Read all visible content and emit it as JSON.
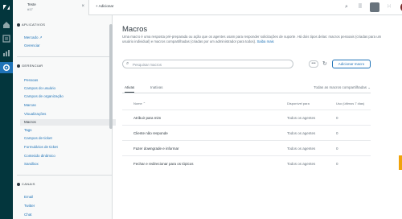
{
  "topbar": {
    "tab_title": "Teste",
    "tab_subtitle": "#17",
    "tab_close": "×",
    "add_tab": "+ Adicionar"
  },
  "sidebar": {
    "sections": [
      {
        "title": "APLICATIVOS",
        "items": [
          "Mercado ↗",
          "Gerenciar"
        ]
      },
      {
        "title": "GERENCIAR",
        "items": [
          "Pessoas",
          "Campos do usuário",
          "Campos de organização",
          "Marcas",
          "Visualizações",
          "Macros",
          "Tags",
          "Campos de ticket",
          "Formulários de ticket",
          "Conteúdo dinâmico",
          "Sandbox"
        ]
      },
      {
        "title": "CANAIS",
        "items": [
          "Email",
          "Twitter",
          "Chat"
        ]
      }
    ],
    "selected": "Macros"
  },
  "main": {
    "title": "Macros",
    "description": "Uma macro é uma resposta pré-preparada ou ação que os agentes usam para responder solicitações de suporte. Há dois tipos delas: macros pessoais (criadas para um usuário individual) e macros compartilhadas (criadas por um administrador para todos).",
    "description_link": "Saiba mais",
    "search_placeholder": "Pesquisar macros",
    "more_label": "•••",
    "add_button": "Adicionar macro",
    "tabs": [
      "Ativas",
      "Inativas"
    ],
    "filter_label": "Todas as macros compartilhadas ⌄",
    "columns": [
      "Nome ⌃",
      "Disponível para",
      "Uso (últimos 7 dias)"
    ],
    "rows": [
      {
        "name": "Atribuir para mim",
        "available": "Todos os agentes",
        "usage": "0"
      },
      {
        "name": "Cliente não responde",
        "available": "Todos os agentes",
        "usage": "0"
      },
      {
        "name": "Fazer downgrade e informar",
        "available": "Todos os agentes",
        "usage": "0"
      },
      {
        "name": "Fechar e redirecionar para os tópicos",
        "available": "Todos os agentes",
        "usage": "0"
      }
    ]
  },
  "colors": {
    "rail": "#03363d",
    "accent": "#1f73b7",
    "help": "#f0a30a"
  }
}
